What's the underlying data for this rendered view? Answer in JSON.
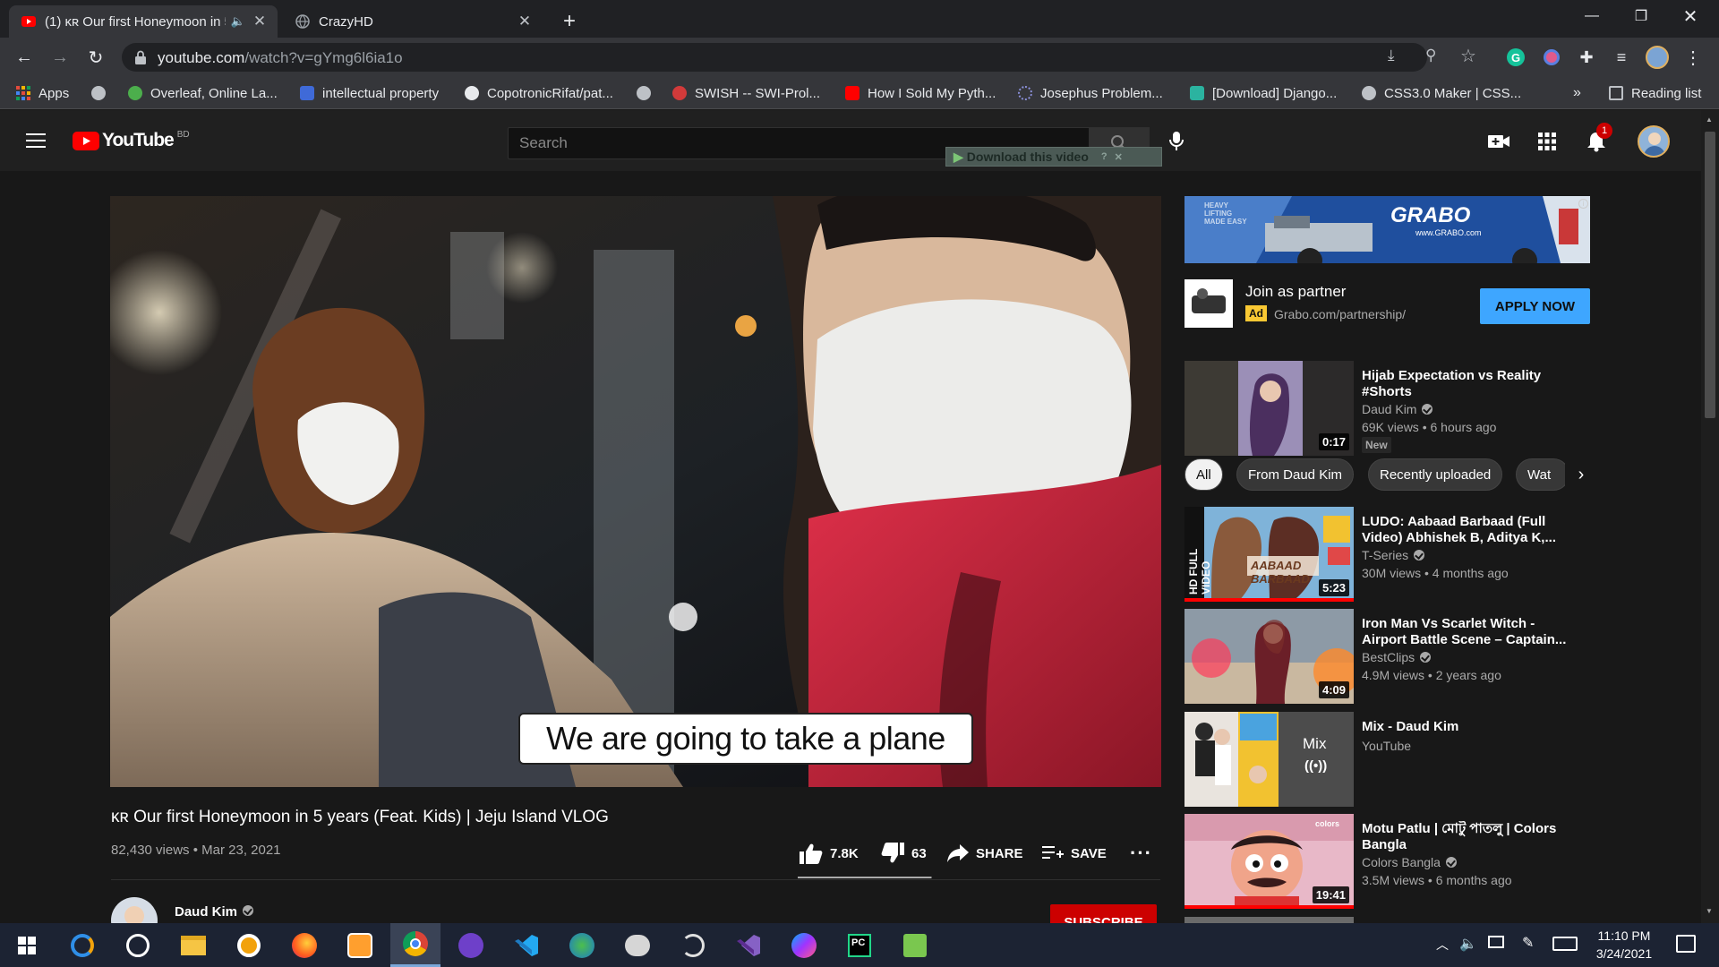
{
  "browser": {
    "tabs": [
      {
        "title": "(1) ᴋʀ Our first Honeymoon in 5 years (Feat. Kids) | Jeju Island VLOG",
        "active": true
      },
      {
        "title": "CrazyHD",
        "active": false
      }
    ],
    "url_host": "youtube.com",
    "url_rest": "/watch?v=gYmg6l6ia1o",
    "bookmarks": [
      {
        "label": "Apps",
        "color": "#e34b3c"
      },
      {
        "label": "",
        "color": "#bdc1c6"
      },
      {
        "label": "Overleaf, Online La...",
        "color": "#4cae4c"
      },
      {
        "label": "intellectual property",
        "color": "#3f6ad8"
      },
      {
        "label": "CopotronicRifat/pat...",
        "color": "#e8eaed"
      },
      {
        "label": "",
        "color": "#bdc1c6"
      },
      {
        "label": "SWISH -- SWI-Prol...",
        "color": "#d23a3a"
      },
      {
        "label": "How I Sold My Pyth...",
        "color": "#ff0000"
      },
      {
        "label": "Josephus Problem...",
        "color": "#8a8fd8"
      },
      {
        "label": "[Download] Django...",
        "color": "#2bb3a0"
      },
      {
        "label": "CSS3.0 Maker | CSS...",
        "color": "#bdc1c6"
      }
    ],
    "bookmarks_more": "»",
    "reading_list": "Reading list"
  },
  "youtube": {
    "logo_text": "YouTube",
    "country": "BD",
    "search_placeholder": "Search",
    "download_bar": "Download this video",
    "notification_count": "1",
    "video": {
      "caption": "We are going to take a plane",
      "title": "ᴋʀ Our first Honeymoon in 5 years (Feat. Kids) | Jeju Island VLOG",
      "meta": "82,430 views • Mar 23, 2021",
      "likes": "7.8K",
      "dislikes": "63",
      "like_ratio": 0.992,
      "share_label": "SHARE",
      "save_label": "SAVE",
      "channel": "Daud Kim",
      "subscribe_label": "SUBSCRIBE"
    },
    "ad": {
      "banner_brand": "GRABO",
      "banner_site": "www.GRABO.com",
      "banner_tagline": "HEAVY LIFTING MADE EASY",
      "title": "Join as partner",
      "badge": "Ad",
      "url": "Grabo.com/partnership/",
      "cta": "APPLY NOW"
    },
    "chips": [
      "All",
      "From Daud Kim",
      "Recently uploaded",
      "Wat"
    ],
    "recommendations": [
      {
        "title": "Hijab Expectation vs Reality #Shorts",
        "channel": "Daud Kim",
        "verified": true,
        "meta": "69K views • 6 hours ago",
        "badge": "New",
        "duration": "0:17",
        "progress": 0
      },
      {
        "title": "LUDO: Aabaad Barbaad (Full Video) Abhishek B, Aditya K,...",
        "channel": "T-Series",
        "verified": true,
        "meta": "30M views • 4 months ago",
        "duration": "5:23",
        "progress": 1.0
      },
      {
        "title": "Iron Man Vs Scarlet Witch - Airport Battle Scene – Captain...",
        "channel": "BestClips",
        "verified": true,
        "meta": "4.9M views • 2 years ago",
        "duration": "4:09",
        "progress": 0
      },
      {
        "title": "Mix - Daud Kim",
        "channel": "YouTube",
        "verified": false,
        "meta": "",
        "mix_label": "Mix",
        "duration": "",
        "progress": 0
      },
      {
        "title": "Motu Patlu | মোটু পাতলু | Colors Bangla",
        "channel": "Colors Bangla",
        "verified": true,
        "meta": "3.5M views • 6 months ago",
        "duration": "19:41",
        "progress": 1.0
      }
    ]
  },
  "taskbar": {
    "time": "11:10 PM",
    "date": "3/24/2021"
  }
}
